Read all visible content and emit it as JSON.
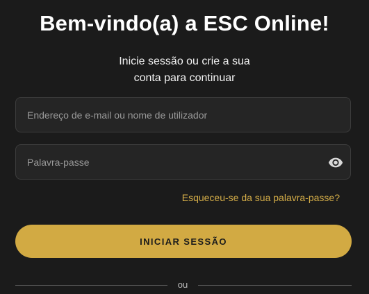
{
  "header": {
    "title": "Bem-vindo(a) a ESC Online!",
    "subtitle_line1": "Inicie sessão ou crie a sua",
    "subtitle_line2": "conta para continuar"
  },
  "form": {
    "email_placeholder": "Endereço de e-mail ou nome de utilizador",
    "email_value": "",
    "password_placeholder": "Palavra-passe",
    "password_value": "",
    "password_toggle_icon": "eye-icon",
    "forgot_link": "Esqueceu-se da sua palavra-passe?",
    "submit_label": "INICIAR SESSÃO"
  },
  "divider": {
    "label": "ou"
  },
  "colors": {
    "background": "#1b1b1b",
    "accent": "#d2aa43",
    "link": "#d4ad48",
    "field_bg": "#252525"
  }
}
